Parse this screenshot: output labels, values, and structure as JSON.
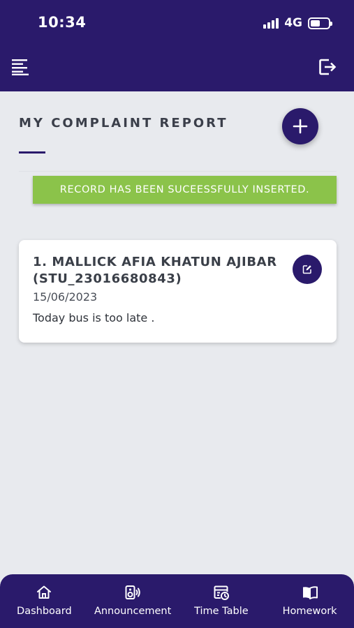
{
  "theme": {
    "primary": "#2a1a6b",
    "success": "#8bc34a",
    "background": "#e8eaee"
  },
  "status_bar": {
    "time": "10:34",
    "network": "4G",
    "icons": [
      "signal-icon",
      "battery-icon"
    ]
  },
  "header": {
    "menu_icon": "menu-icon",
    "logout_icon": "logout-icon"
  },
  "page": {
    "title": "MY COMPLAINT REPORT",
    "add_icon": "plus-icon"
  },
  "toast": {
    "message": "RECORD HAS BEEN SUCEESSFULLY INSERTED."
  },
  "complaints": [
    {
      "name": "1. MALLICK AFIA KHATUN AJIBAR (STU_23016680843)",
      "date": "15/06/2023",
      "description": "Today bus is too late .",
      "edit_icon": "edit-icon"
    }
  ],
  "bottom_nav": [
    {
      "label": "Dashboard",
      "icon": "home-icon"
    },
    {
      "label": "Announcement",
      "icon": "speaker-icon"
    },
    {
      "label": "Time Table",
      "icon": "calendar-clock-icon"
    },
    {
      "label": "Homework",
      "icon": "book-icon"
    }
  ]
}
